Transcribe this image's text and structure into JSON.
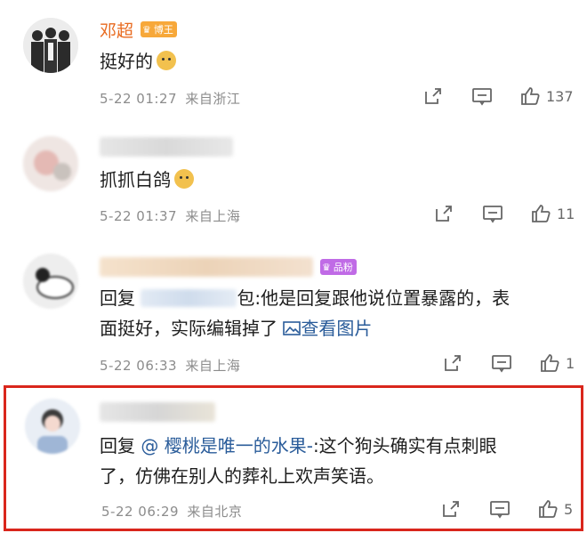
{
  "comments": [
    {
      "name": "邓超",
      "badge": "博王",
      "text": "挺好的",
      "date": "5-22 01:27",
      "source": "来自浙江",
      "likes": "137"
    },
    {
      "name": "",
      "text": "抓抓白鸽",
      "date": "5-22 01:37",
      "source": "来自上海",
      "likes": "11"
    },
    {
      "name": "",
      "badge": "品粉",
      "reply_prefix": "回复",
      "reply_target_suffix": "包:",
      "text_line1": "他是回复跟他说位置暴露的，表",
      "text_line2": "面挺好，实际编辑掉了",
      "image_link": "查看图片",
      "date": "5-22 06:33",
      "source": "来自上海",
      "likes": "1"
    },
    {
      "name": "",
      "reply_prefix": "回复",
      "mention": "@ 樱桃是唯一的水果-",
      "text_line1": ":这个狗头确实有点刺眼",
      "text_line2": "了，仿佛在别人的葬礼上欢声笑语。",
      "date": "5-22 06:29",
      "source": "来自北京",
      "likes": "5"
    }
  ],
  "colors": {
    "name": "#e86a1f",
    "link": "#2a5c9a",
    "highlight_border": "#d9261c"
  },
  "icons": {
    "share": "share-icon",
    "comment": "comment-icon",
    "like": "thumbs-up-icon",
    "image": "image-icon",
    "emoji": "dog-face-emoji"
  }
}
